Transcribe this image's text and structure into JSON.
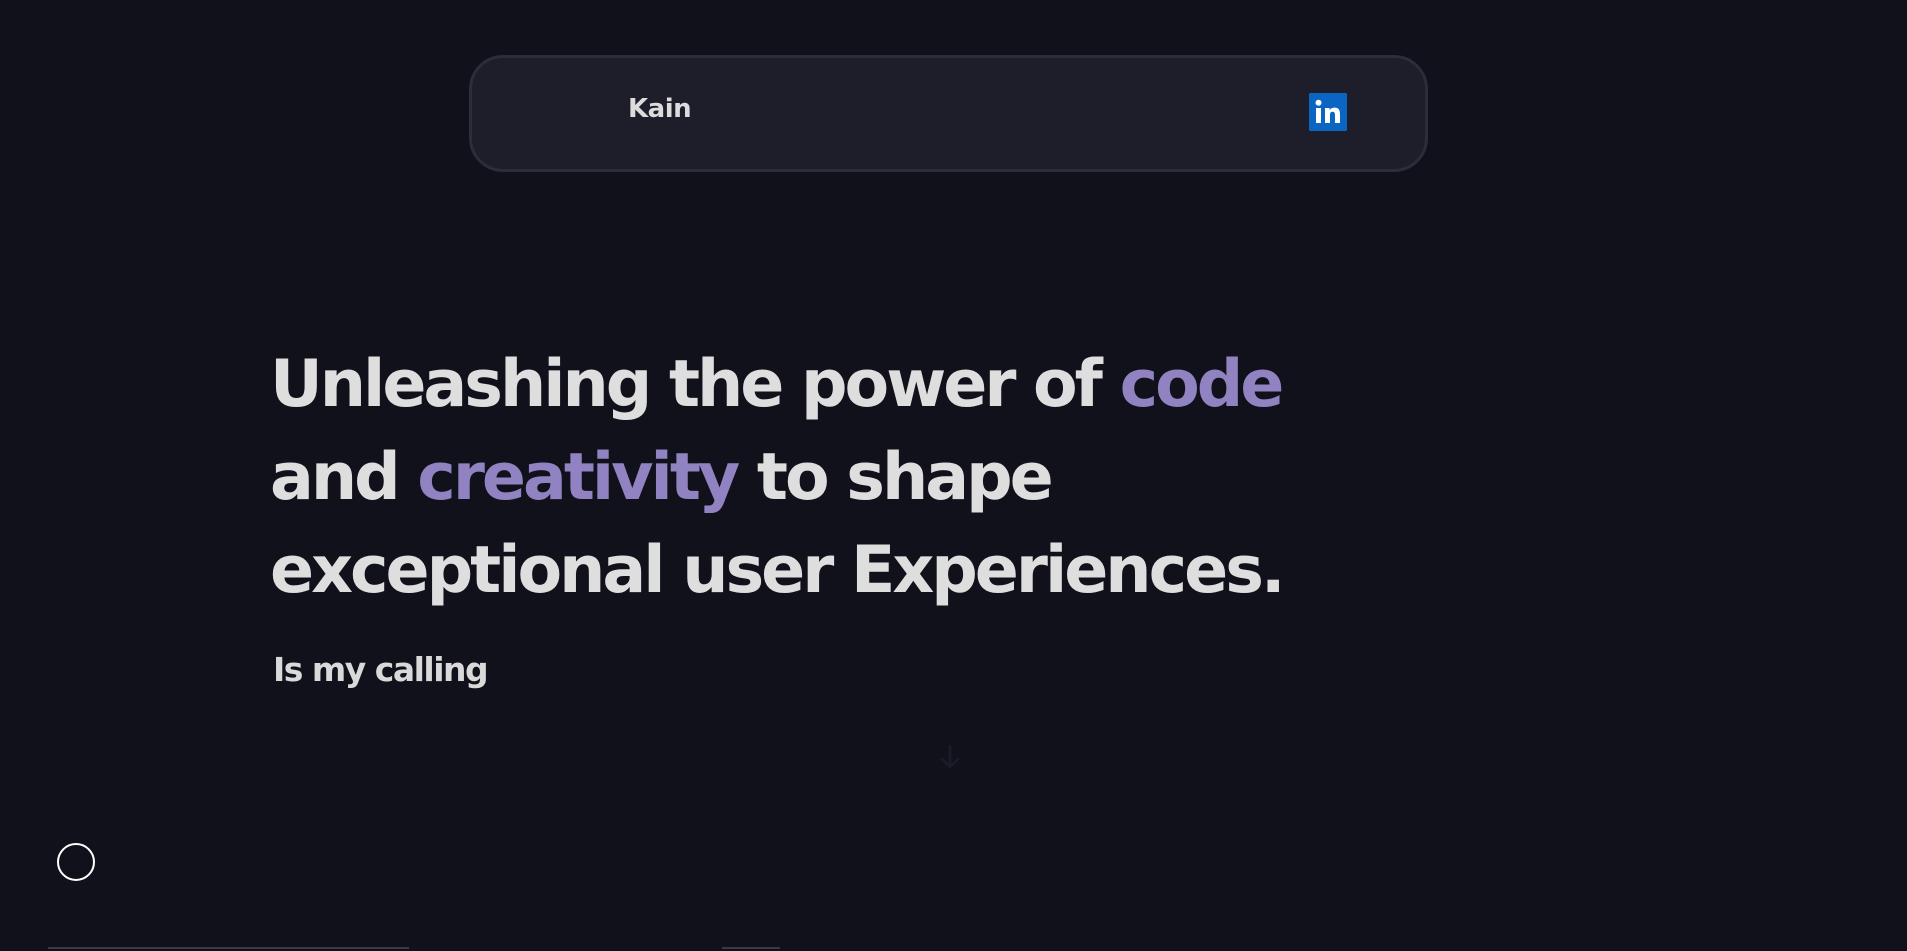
{
  "navbar": {
    "brand": "Kain",
    "social": {
      "icon": "linkedin-icon",
      "glyph": "in",
      "color": "#0a66c2"
    }
  },
  "hero": {
    "headline_parts": [
      {
        "text": "Unleashing the power of ",
        "accent": false
      },
      {
        "text": "code",
        "accent": true
      },
      {
        "text": " and ",
        "accent": false
      },
      {
        "text": "creativity",
        "accent": true
      },
      {
        "text": " to shape exceptional user Experiences.",
        "accent": false
      }
    ],
    "subline": "Is my calling",
    "accent_color": "#9183c2"
  },
  "scroll_indicator": {
    "icon": "arrow-down-icon"
  },
  "cursor": {
    "icon": "cursor-circle-icon"
  }
}
